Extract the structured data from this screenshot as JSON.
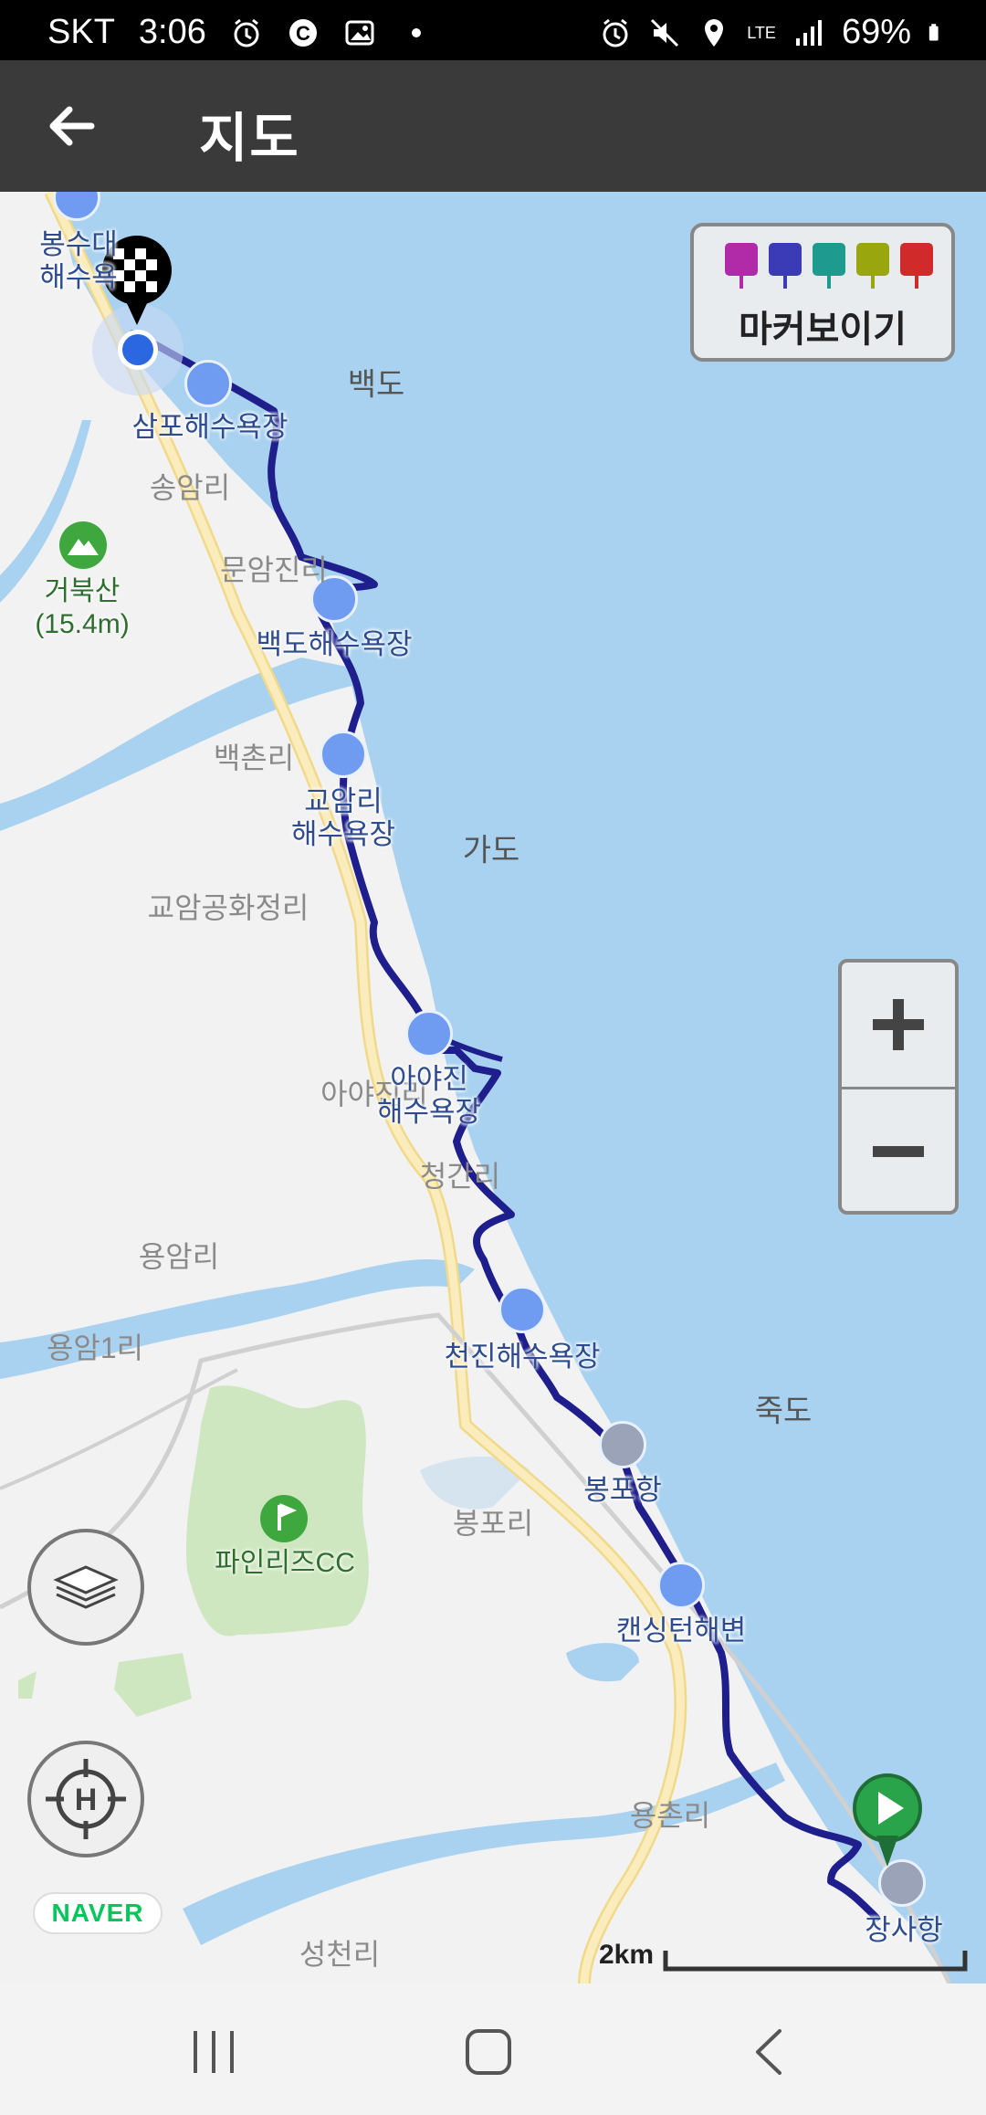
{
  "status_bar": {
    "carrier": "SKT",
    "time": "3:06",
    "network": "LTE",
    "battery": "69%",
    "icons_left": [
      "alarm-icon",
      "c-icon",
      "gallery-icon",
      "dot-icon"
    ],
    "icons_right": [
      "alarm-icon",
      "mute-icon",
      "location-icon",
      "lte-icon",
      "signal-icon",
      "battery-icon"
    ]
  },
  "app_bar": {
    "title": "지도",
    "back_icon": "arrow-left-icon"
  },
  "map": {
    "marker_toggle_label": "마커보이기",
    "marker_flag_colors": [
      "#b12aa8",
      "#3b3bb5",
      "#1e9a8e",
      "#9aa60e",
      "#d12a2a"
    ],
    "route_color": "#1e1e8c",
    "water_color": "#a9d2f0",
    "land_color": "#f2f2f2",
    "park_color": "#cfe7c0",
    "road_color": "#f7e3a3",
    "labels": {
      "bongsudae": "봉수대\n해수욕",
      "baekdo_island": "백도",
      "sampo_beach": "삼포해수욕장",
      "songam": "송암리",
      "geobuksan": "거북산\n(15.4m)",
      "munamjin": "문암진리",
      "baekdo_beach": "백도해수욕장",
      "baekchon": "백촌리",
      "gyoam_beach": "교암리\n해수욕장",
      "gado": "가도",
      "gyoam_gonghwa": "교암공화정리",
      "ayajin_beach": "아야진\n해수욕장",
      "ayajin_ri": "아야진리",
      "cheonggan": "청간리",
      "yongam": "용암리",
      "yongam1": "용암1리",
      "cheonjin_beach": "천진해수욕장",
      "jukdo": "죽도",
      "bongpo_port": "봉포항",
      "bongpo_ri": "봉포리",
      "pine_cc": "파인리즈CC",
      "kensington": "캔싱턴해변",
      "yongchon": "용촌리",
      "jangsa_port": "장사항",
      "seongcheon": "성천리"
    },
    "zoom_in_label": "+",
    "zoom_out_label": "−",
    "layers_icon": "layers-icon",
    "home_icon": "home-target-icon",
    "attribution": "NAVER",
    "scale_label": "2km"
  },
  "nav_bar": {
    "icons": [
      "recent-apps-icon",
      "home-icon",
      "back-icon"
    ]
  }
}
